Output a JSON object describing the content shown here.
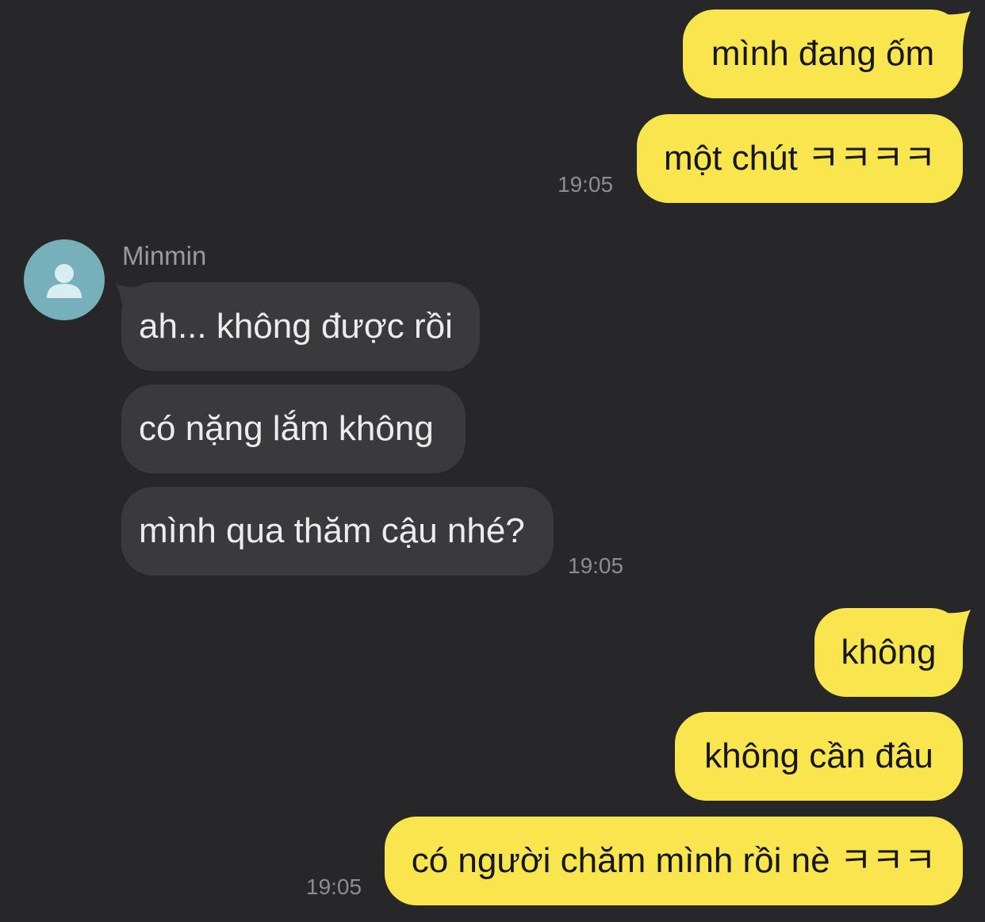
{
  "theme": {
    "background": "#27272a",
    "outgoing_bubble": "#f9e54e",
    "incoming_bubble": "#3a3a3d",
    "avatar_color": "#76b1bb"
  },
  "contact": {
    "name": "Minmin",
    "avatar_icon": "person-silhouette-icon"
  },
  "messages": {
    "m1": "mình đang ốm",
    "m2": "một chút ㅋㅋㅋㅋ",
    "m3": "ah... không được rồi",
    "m4": "có nặng lắm không",
    "m5": "mình qua thăm cậu nhé?",
    "m6": "không",
    "m7": "không cần đâu",
    "m8": "có người chăm mình rồi nè ㅋㅋㅋ"
  },
  "timestamps": {
    "group1": "19:05",
    "group2": "19:05",
    "group3": "19:05"
  }
}
